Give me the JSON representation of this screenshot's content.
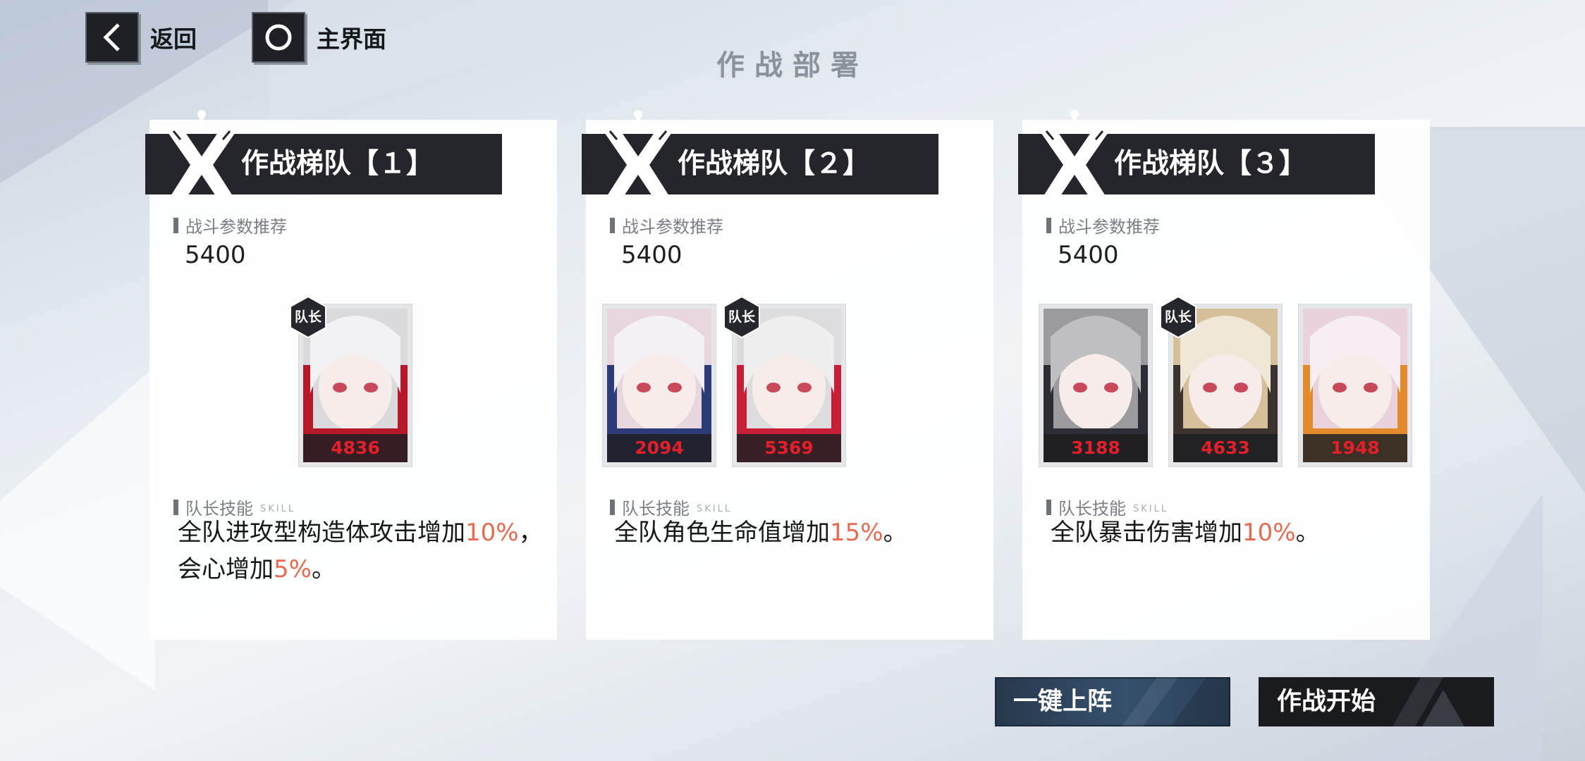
{
  "nav": {
    "back_label": "返回",
    "home_label": "主界面"
  },
  "page_title": "作战部署",
  "teams": [
    {
      "title": "作战梯队【１】",
      "power_label": "战斗参数推荐",
      "power_value": "5400",
      "skill_label": "队长技能",
      "skill_label_en": "SKILL",
      "members": [
        {
          "power": "4836",
          "leader": true
        }
      ],
      "skill_parts": [
        "全队进攻型构造体攻击增加",
        "10%",
        "，会心增加",
        "5%",
        "。"
      ]
    },
    {
      "title": "作战梯队【２】",
      "power_label": "战斗参数推荐",
      "power_value": "5400",
      "skill_label": "队长技能",
      "skill_label_en": "SKILL",
      "members": [
        {
          "power": "2094",
          "leader": false
        },
        {
          "power": "5369",
          "leader": true
        }
      ],
      "skill_parts": [
        "全队角色生命值增加",
        "15%",
        "。"
      ]
    },
    {
      "title": "作战梯队【３】",
      "power_label": "战斗参数推荐",
      "power_value": "5400",
      "skill_label": "队长技能",
      "skill_label_en": "SKILL",
      "members": [
        {
          "power": "3188",
          "leader": false
        },
        {
          "power": "4633",
          "leader": true
        },
        {
          "power": "1948",
          "leader": false
        }
      ],
      "skill_parts": [
        "全队暴击伤害增加",
        "10%",
        "。"
      ]
    }
  ],
  "leader_badge": "队长",
  "actions": {
    "auto_label": "一键上阵",
    "start_label": "作战开始"
  },
  "colors": {
    "highlight": "#e66a52",
    "power_text": "#e3202a",
    "header_bg": "#24262b"
  }
}
